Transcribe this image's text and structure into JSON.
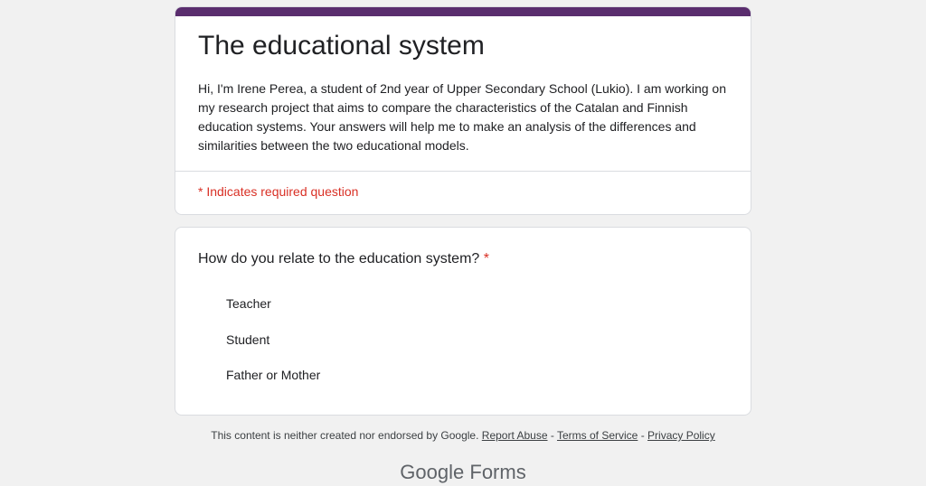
{
  "form": {
    "accent_color": "#5a2d6e",
    "title": "The educational system",
    "description": "Hi, I'm Irene Perea, a student of 2nd year of Upper Secondary School (Lukio). I am working on my research project that aims to compare the characteristics of the Catalan and Finnish education systems. Your answers will help me to make an analysis of the differences and similarities between the two educational models.",
    "required_note": "* Indicates required question"
  },
  "question": {
    "title": "How do you relate to the education system?",
    "required_marker": "*",
    "options": [
      "Teacher",
      "Student",
      "Father or Mother"
    ]
  },
  "footer": {
    "text": "This content is neither created nor endorsed by Google.",
    "report_abuse": "Report Abuse",
    "separator": "-",
    "terms": "Terms of Service",
    "privacy": "Privacy Policy"
  },
  "brand": {
    "google": "Google",
    "forms": "Forms"
  }
}
